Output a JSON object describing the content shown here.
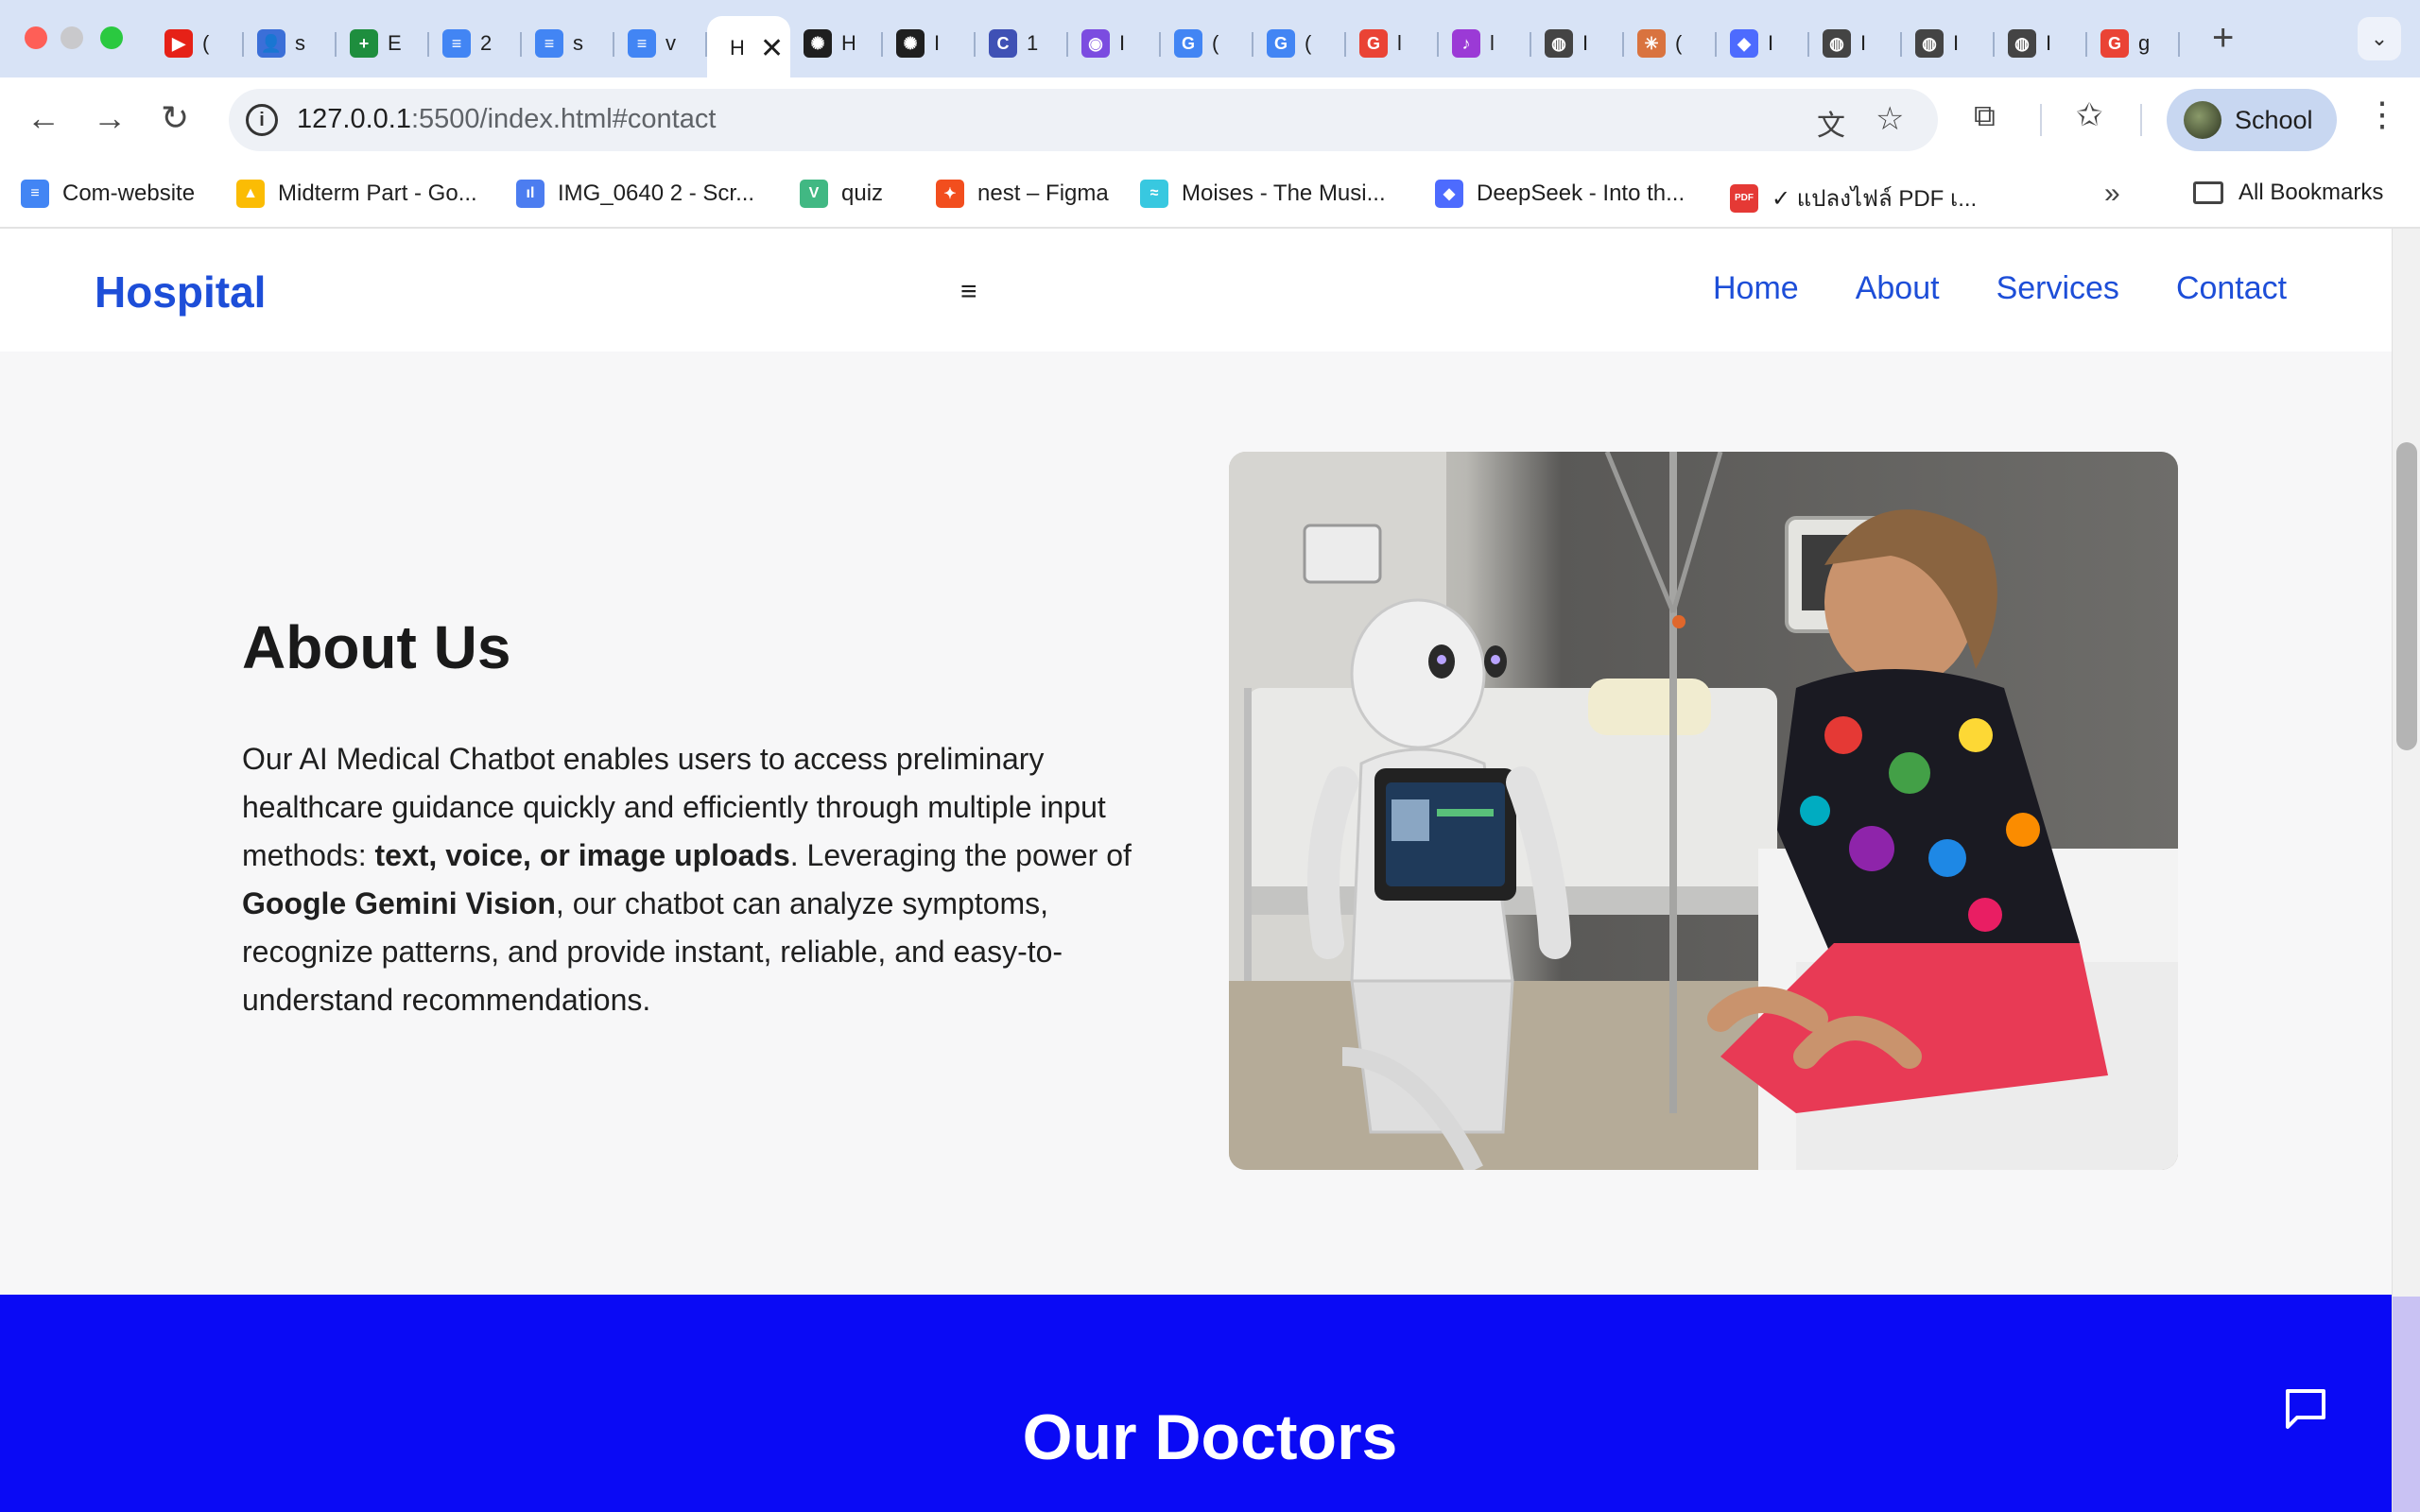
{
  "browser": {
    "tabs": [
      {
        "title": "(",
        "color": "#e62117",
        "glyph": "▶"
      },
      {
        "title": "s",
        "color": "#3b6fd8",
        "glyph": "👤"
      },
      {
        "title": "E",
        "color": "#1e8e3e",
        "glyph": "+"
      },
      {
        "title": "2",
        "color": "#4285f4",
        "glyph": "≡"
      },
      {
        "title": "s",
        "color": "#4285f4",
        "glyph": "≡"
      },
      {
        "title": "v",
        "color": "#4285f4",
        "glyph": "≡"
      },
      {
        "title": "H",
        "color": "#ffffff",
        "glyph": "",
        "active": true
      },
      {
        "title": "H",
        "color": "#1f1f1f",
        "glyph": "✺"
      },
      {
        "title": "I",
        "color": "#1f1f1f",
        "glyph": "✺"
      },
      {
        "title": "1",
        "color": "#3f51b5",
        "glyph": "C"
      },
      {
        "title": "I",
        "color": "#7b4ce0",
        "glyph": "◉"
      },
      {
        "title": "(",
        "color": "#4285f4",
        "glyph": "G"
      },
      {
        "title": "(",
        "color": "#4285f4",
        "glyph": "G"
      },
      {
        "title": "l",
        "color": "#ea4335",
        "glyph": "G"
      },
      {
        "title": "l",
        "color": "#9b3ad6",
        "glyph": "♪"
      },
      {
        "title": "I",
        "color": "#444444",
        "glyph": "◍"
      },
      {
        "title": "(",
        "color": "#d9733f",
        "glyph": "✳"
      },
      {
        "title": "I",
        "color": "#4d6bfe",
        "glyph": "◆"
      },
      {
        "title": "I",
        "color": "#444444",
        "glyph": "◍"
      },
      {
        "title": "I",
        "color": "#444444",
        "glyph": "◍"
      },
      {
        "title": "I",
        "color": "#444444",
        "glyph": "◍"
      },
      {
        "title": "g",
        "color": "#ea4335",
        "glyph": "G"
      }
    ],
    "url_host": "127.0.0.1",
    "url_path": ":5500/index.html#contact",
    "profile_name": "School",
    "bookmarks": [
      {
        "label": "Com-website",
        "color": "#4285f4",
        "glyph": "≡"
      },
      {
        "label": "Midterm Part - Go...",
        "color": "#fbbc04",
        "glyph": "▲"
      },
      {
        "label": "IMG_0640 2 - Scr...",
        "color": "#4c7df0",
        "glyph": "ıl"
      },
      {
        "label": "quiz",
        "color": "#41b883",
        "glyph": "V"
      },
      {
        "label": "nest – Figma",
        "color": "#f24e1e",
        "glyph": "✦"
      },
      {
        "label": "Moises - The Musi...",
        "color": "#38c8e0",
        "glyph": "≈"
      },
      {
        "label": "DeepSeek - Into th...",
        "color": "#4d6bfe",
        "glyph": "◆"
      },
      {
        "label": "✓ แปลงไฟล์ PDF เ...",
        "color": "#e53935",
        "glyph": "PDF"
      }
    ],
    "all_bookmarks": "All Bookmarks"
  },
  "site": {
    "brand": "Hospital",
    "menu_icon": "≡",
    "nav": [
      "Home",
      "About",
      "Services",
      "Contact"
    ],
    "about": {
      "title": "About Us",
      "p_part1": "Our AI Medical Chatbot enables users to access preliminary healthcare guidance quickly and efficiently through multiple input methods: ",
      "p_bold1": "text, voice, or image uploads",
      "p_part2": ". Leveraging the power of ",
      "p_bold2": "Google Gemini Vision",
      "p_part3": ", our chatbot can analyze symptoms, recognize patterns, and provide instant, reliable, and easy-to-understand recommendations."
    },
    "doctors_title": "Our Doctors"
  },
  "colors": {
    "brand_blue": "#1d4ed8",
    "doctors_bg": "#0a0af5"
  }
}
